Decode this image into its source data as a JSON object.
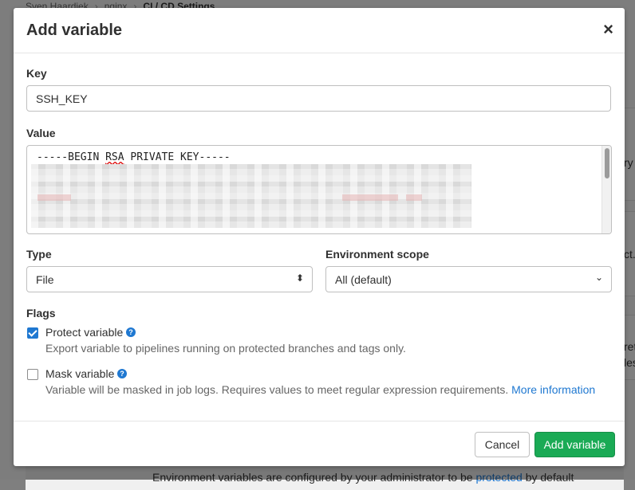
{
  "background": {
    "breadcrumb": [
      "Sven Haardiek",
      "nginx",
      "CI / CD Settings"
    ],
    "fragments": [
      "ry",
      "ct.",
      "ret",
      "les"
    ],
    "footer_text": "Environment variables are configured by your administrator to be ",
    "footer_link": "protected",
    "footer_tail": " by default"
  },
  "modal": {
    "title": "Add variable",
    "close_icon": "×",
    "key_label": "Key",
    "key_value": "SSH_KEY",
    "value_label": "Value",
    "value_first_line_pre": "-----BEGIN ",
    "value_first_line_spell": "RSA",
    "value_first_line_post": " PRIVATE KEY-----",
    "type_label": "Type",
    "type_value": "File",
    "env_label": "Environment scope",
    "env_value": "All (default)",
    "flags_label": "Flags",
    "protect": {
      "label": "Protect variable",
      "checked": true,
      "help": "Export variable to pipelines running on protected branches and tags only."
    },
    "mask": {
      "label": "Mask variable",
      "checked": false,
      "help": "Variable will be masked in job logs. Requires values to meet regular expression requirements.",
      "link": "More information"
    },
    "cancel_label": "Cancel",
    "submit_label": "Add variable"
  },
  "colors": {
    "accent": "#1f78d1",
    "submit": "#1aaa55"
  }
}
